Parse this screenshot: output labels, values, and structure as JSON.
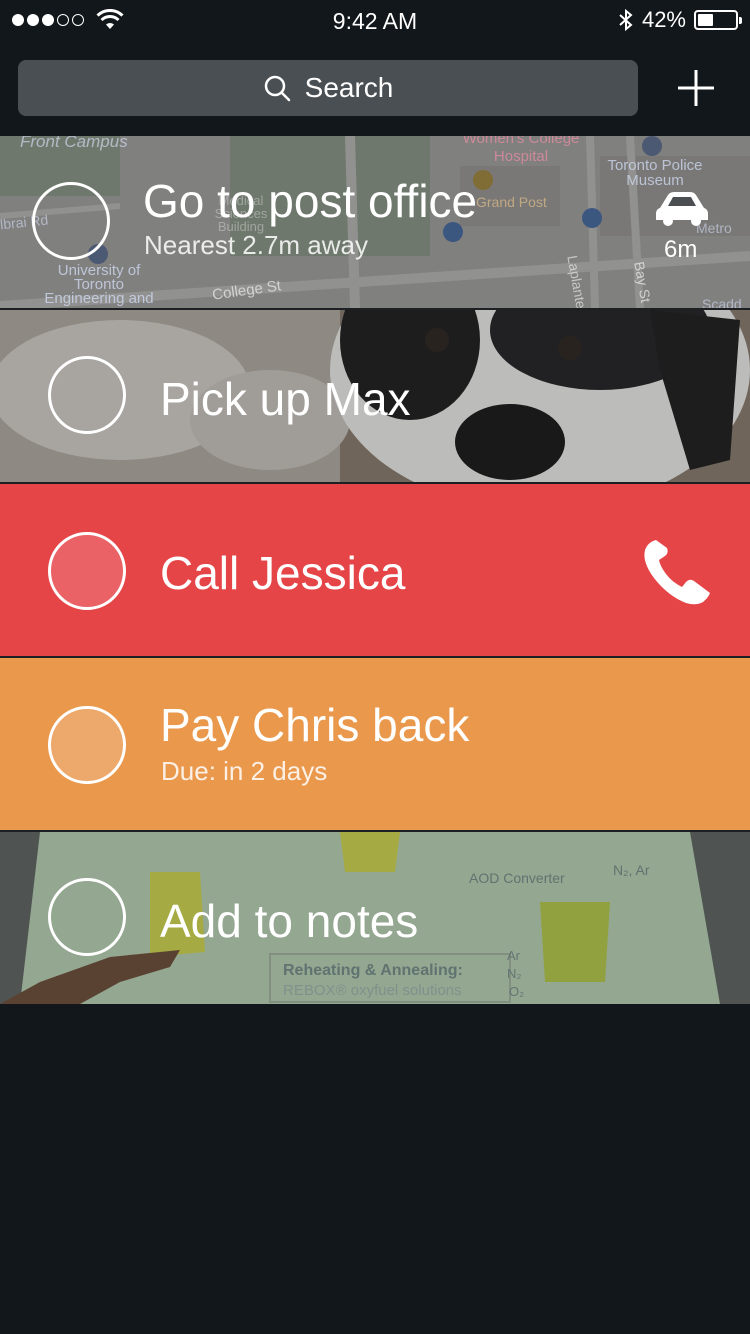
{
  "status": {
    "time": "9:42 AM",
    "battery": "42%",
    "battery_level": 0.42
  },
  "search": {
    "placeholder": "Search"
  },
  "tasks": [
    {
      "title": "Go to post office",
      "subtitle": "Nearest 2.7m away",
      "travel_time": "6m",
      "icon": "car-icon",
      "map_labels": [
        "Front Campus",
        "Women's College Hospital",
        "Toronto Police Museum",
        "University of Toronto Engineering and",
        "College St",
        "Laplante",
        "Bay St",
        "Metro",
        "Scadd",
        "lbrai Rd",
        "Medical Sciences Building",
        "Grand Post"
      ]
    },
    {
      "title": "Pick up Max"
    },
    {
      "title": "Call Jessica",
      "icon": "phone-icon",
      "color": "#e64548"
    },
    {
      "title": "Pay Chris back",
      "subtitle": "Due: in 2 days",
      "color": "#ea984c"
    },
    {
      "title": "Add to notes",
      "whiteboard_labels": [
        "AOD Converter",
        "N₂, Ar",
        "Reheating & Annealing:",
        "REBOX® oxyfuel solutions",
        "Ar",
        "N₂",
        "O₂"
      ]
    }
  ]
}
